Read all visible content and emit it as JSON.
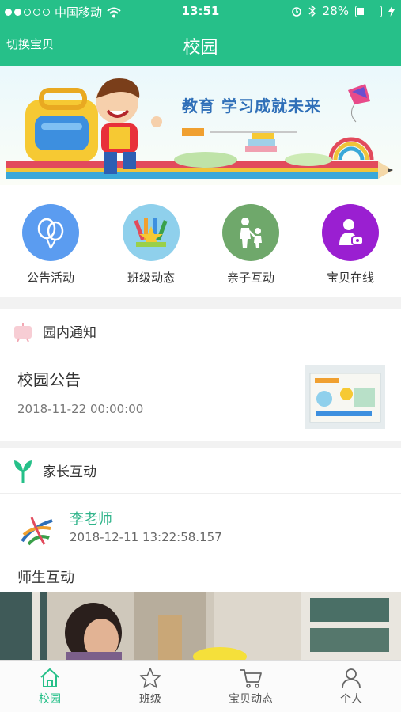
{
  "status_bar": {
    "carrier": "中国移动",
    "time": "13:51",
    "battery": "28%",
    "battery_level": 0.28
  },
  "nav": {
    "left": "切换宝贝",
    "title": "校园"
  },
  "banner": {
    "slogan": "教育 学习成就未来"
  },
  "quick_actions": [
    {
      "label": "公告活动",
      "icon": "balloons-icon",
      "color": "#5b9cf0"
    },
    {
      "label": "班级动态",
      "icon": "pencils-star-icon",
      "color": "#8fd0ec"
    },
    {
      "label": "亲子互动",
      "icon": "parent-child-icon",
      "color": "#6fa86b"
    },
    {
      "label": "宝贝在线",
      "icon": "baby-online-icon",
      "color": "#9a1fd1"
    }
  ],
  "notices": {
    "section_title": "园内通知",
    "item_title": "校园公告",
    "item_date": "2018-11-22 00:00:00"
  },
  "interaction": {
    "section_title": "家长互动",
    "author": "李老师",
    "time": "2018-12-11 13:22:58.157",
    "post_title": "师生互动"
  },
  "tabs": [
    {
      "label": "校园",
      "icon": "home-icon",
      "active": true
    },
    {
      "label": "班级",
      "icon": "star-icon",
      "active": false
    },
    {
      "label": "宝贝动态",
      "icon": "cart-icon",
      "active": false
    },
    {
      "label": "个人",
      "icon": "person-icon",
      "active": false
    }
  ],
  "colors": {
    "brand": "#26c089",
    "author": "#2fb48a"
  }
}
